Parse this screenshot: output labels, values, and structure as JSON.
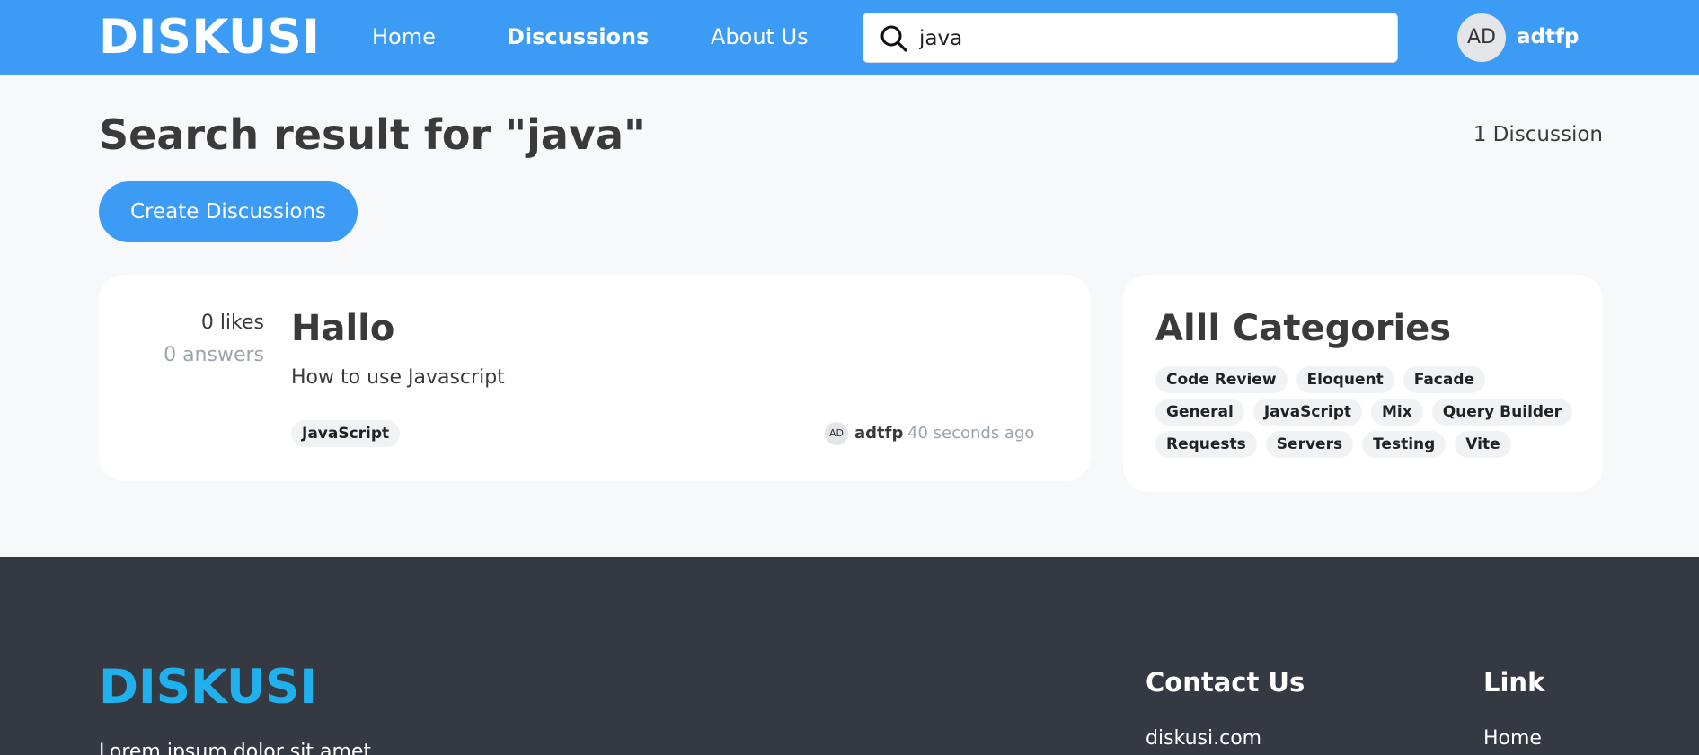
{
  "navbar": {
    "brand": "DISKUSI",
    "links": [
      {
        "label": "Home"
      },
      {
        "label": "Discussions"
      },
      {
        "label": "About Us"
      }
    ],
    "search": {
      "value": "java",
      "placeholder": ""
    },
    "user": {
      "initials": "AD",
      "name": "adtfp"
    }
  },
  "header": {
    "title": "Search result for \"java\"",
    "count": "1 Discussion",
    "create_label": "Create Discussions"
  },
  "discussions": [
    {
      "likes": "0 likes",
      "answers": "0 answers",
      "title": "Hallo",
      "body": "How to use Javascript",
      "tag": "JavaScript",
      "author_initials": "AD",
      "author": "adtfp",
      "time": "40 seconds ago"
    }
  ],
  "categories": {
    "title": "Alll Categories",
    "items": [
      "Code Review",
      "Eloquent",
      "Facade",
      "General",
      "JavaScript",
      "Mix",
      "Query Builder",
      "Requests",
      "Servers",
      "Testing",
      "Vite"
    ]
  },
  "footer": {
    "brand": "DISKUSI",
    "text": "Lorem ipsum dolor sit amet",
    "contact_title": "Contact Us",
    "contact_item": "diskusi.com",
    "link_title": "Link",
    "link_item": "Home"
  },
  "colors": {
    "primary": "#3c9bf4",
    "footer_bg": "#353942",
    "footer_brand": "#1fb1ee",
    "page_bg": "#f7f8fa"
  },
  "icons": {
    "search": "search-icon"
  }
}
